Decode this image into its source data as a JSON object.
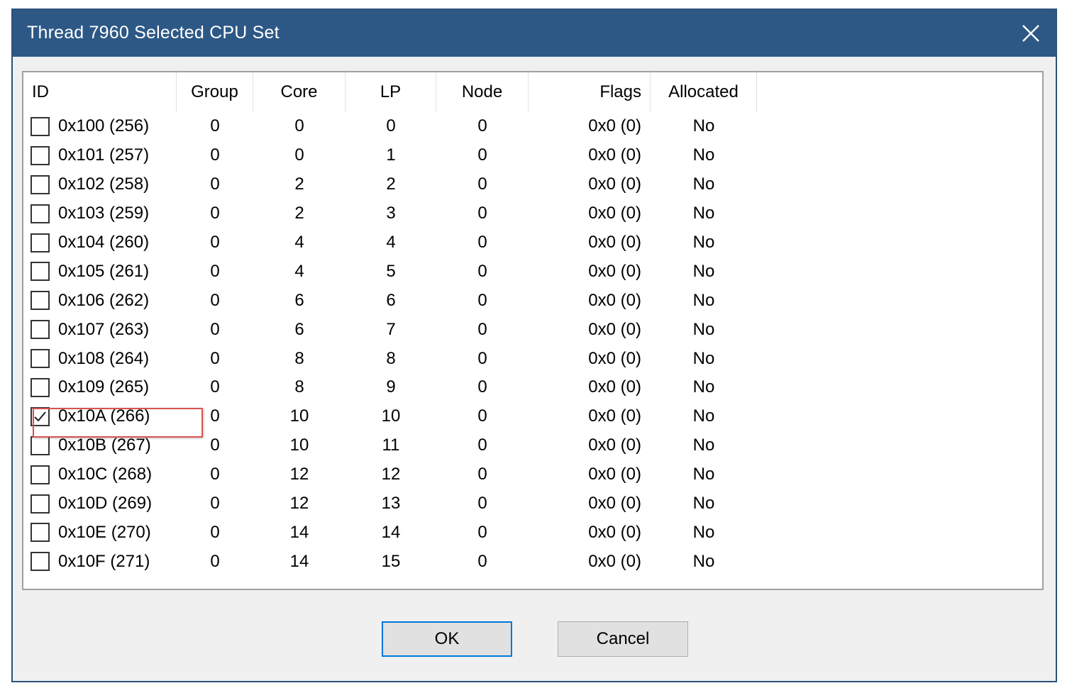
{
  "window": {
    "title": "Thread 7960 Selected CPU Set"
  },
  "columns": [
    "ID",
    "Group",
    "Core",
    "LP",
    "Node",
    "Flags",
    "Allocated"
  ],
  "rows": [
    {
      "id": "0x100 (256)",
      "group": "0",
      "core": "0",
      "lp": "0",
      "node": "0",
      "flags": "0x0 (0)",
      "allocated": "No",
      "checked": false
    },
    {
      "id": "0x101 (257)",
      "group": "0",
      "core": "0",
      "lp": "1",
      "node": "0",
      "flags": "0x0 (0)",
      "allocated": "No",
      "checked": false
    },
    {
      "id": "0x102 (258)",
      "group": "0",
      "core": "2",
      "lp": "2",
      "node": "0",
      "flags": "0x0 (0)",
      "allocated": "No",
      "checked": false
    },
    {
      "id": "0x103 (259)",
      "group": "0",
      "core": "2",
      "lp": "3",
      "node": "0",
      "flags": "0x0 (0)",
      "allocated": "No",
      "checked": false
    },
    {
      "id": "0x104 (260)",
      "group": "0",
      "core": "4",
      "lp": "4",
      "node": "0",
      "flags": "0x0 (0)",
      "allocated": "No",
      "checked": false
    },
    {
      "id": "0x105 (261)",
      "group": "0",
      "core": "4",
      "lp": "5",
      "node": "0",
      "flags": "0x0 (0)",
      "allocated": "No",
      "checked": false
    },
    {
      "id": "0x106 (262)",
      "group": "0",
      "core": "6",
      "lp": "6",
      "node": "0",
      "flags": "0x0 (0)",
      "allocated": "No",
      "checked": false
    },
    {
      "id": "0x107 (263)",
      "group": "0",
      "core": "6",
      "lp": "7",
      "node": "0",
      "flags": "0x0 (0)",
      "allocated": "No",
      "checked": false
    },
    {
      "id": "0x108 (264)",
      "group": "0",
      "core": "8",
      "lp": "8",
      "node": "0",
      "flags": "0x0 (0)",
      "allocated": "No",
      "checked": false
    },
    {
      "id": "0x109 (265)",
      "group": "0",
      "core": "8",
      "lp": "9",
      "node": "0",
      "flags": "0x0 (0)",
      "allocated": "No",
      "checked": false
    },
    {
      "id": "0x10A (266)",
      "group": "0",
      "core": "10",
      "lp": "10",
      "node": "0",
      "flags": "0x0 (0)",
      "allocated": "No",
      "checked": true
    },
    {
      "id": "0x10B (267)",
      "group": "0",
      "core": "10",
      "lp": "11",
      "node": "0",
      "flags": "0x0 (0)",
      "allocated": "No",
      "checked": false
    },
    {
      "id": "0x10C (268)",
      "group": "0",
      "core": "12",
      "lp": "12",
      "node": "0",
      "flags": "0x0 (0)",
      "allocated": "No",
      "checked": false
    },
    {
      "id": "0x10D (269)",
      "group": "0",
      "core": "12",
      "lp": "13",
      "node": "0",
      "flags": "0x0 (0)",
      "allocated": "No",
      "checked": false
    },
    {
      "id": "0x10E (270)",
      "group": "0",
      "core": "14",
      "lp": "14",
      "node": "0",
      "flags": "0x0 (0)",
      "allocated": "No",
      "checked": false
    },
    {
      "id": "0x10F (271)",
      "group": "0",
      "core": "14",
      "lp": "15",
      "node": "0",
      "flags": "0x0 (0)",
      "allocated": "No",
      "checked": false
    }
  ],
  "buttons": {
    "ok": "OK",
    "cancel": "Cancel"
  },
  "icons": {
    "close": "close-icon",
    "check": "checkmark-icon"
  },
  "colors": {
    "titlebar": "#2d5886",
    "highlight": "#d9534f",
    "focus": "#0078d7"
  }
}
